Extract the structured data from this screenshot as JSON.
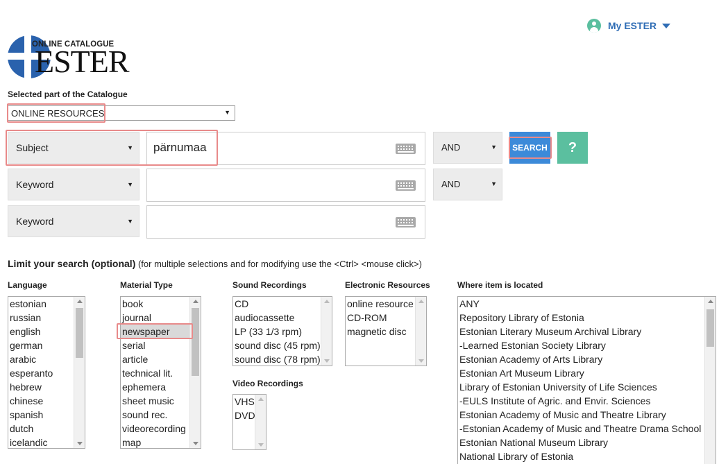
{
  "header": {
    "account_label": "My ESTER",
    "logo_subtitle": "ONLINE CATALOGUE",
    "logo_name": "ESTER"
  },
  "catalogue": {
    "label": "Selected part of the Catalogue",
    "selected": "ONLINE RESOURCES"
  },
  "search_rows": [
    {
      "field": "Subject",
      "term": "pärnumaa",
      "operator": "AND"
    },
    {
      "field": "Keyword",
      "term": "",
      "operator": "AND"
    },
    {
      "field": "Keyword",
      "term": ""
    }
  ],
  "buttons": {
    "search": "SEARCH",
    "help": "?"
  },
  "limit": {
    "title": "Limit your search (optional)",
    "hint": " (for multiple selections and for modifying use the <Ctrl> <mouse click>)"
  },
  "filters": {
    "language": {
      "label": "Language",
      "options": [
        "estonian",
        "russian",
        "english",
        "german",
        "arabic",
        "esperanto",
        "hebrew",
        "chinese",
        "spanish",
        "dutch",
        "icelandic"
      ]
    },
    "material_type": {
      "label": "Material Type",
      "options": [
        "book",
        "journal",
        "newspaper",
        "serial",
        "article",
        "technical lit.",
        "ephemera",
        "sheet music",
        "sound rec.",
        "videorecording",
        "map"
      ],
      "selected": "newspaper"
    },
    "sound_recordings": {
      "label": "Sound Recordings",
      "options": [
        "CD",
        "audiocassette",
        "LP (33 1/3 rpm)",
        "sound disc (45 rpm)",
        "sound disc (78 rpm)"
      ]
    },
    "electronic_resources": {
      "label": "Electronic Resources",
      "options": [
        "online resource",
        "CD-ROM",
        "magnetic disc"
      ]
    },
    "video_recordings": {
      "label": "Video Recordings",
      "options": [
        "VHS",
        "DVD"
      ]
    },
    "location": {
      "label": "Where item is located",
      "options": [
        "ANY",
        "Repository Library of Estonia",
        "Estonian Literary Museum Archival Library",
        "-Learned Estonian Society Library",
        "Estonian Academy of Arts Library",
        "Estonian Art Museum Library",
        "Library of Estonian University of Life Sciences",
        "-EULS Institute of Agric. and Envir. Sciences",
        "Estonian Academy of Music and Theatre Library",
        "-Estonian Academy of Music and Theatre Drama School",
        "Estonian National Museum Library",
        "National Library of Estonia"
      ]
    }
  },
  "colors": {
    "accent_blue": "#3c8ad9",
    "accent_green": "#5bbf9f",
    "highlight_red": "#e88a8a",
    "logo_blue": "#2a62ad"
  }
}
